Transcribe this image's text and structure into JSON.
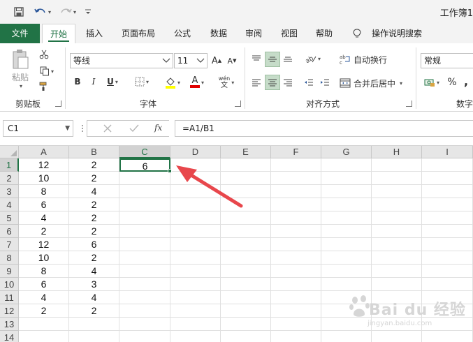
{
  "window": {
    "title": "工作簿1"
  },
  "qat": {
    "save_icon": "save-icon",
    "undo_icon": "undo-icon",
    "redo_icon": "redo-icon",
    "customize_icon": "qat-customize-icon"
  },
  "tabs": [
    {
      "id": "file",
      "label": "文件"
    },
    {
      "id": "home",
      "label": "开始"
    },
    {
      "id": "insert",
      "label": "插入"
    },
    {
      "id": "layout",
      "label": "页面布局"
    },
    {
      "id": "formulas",
      "label": "公式"
    },
    {
      "id": "data",
      "label": "数据"
    },
    {
      "id": "review",
      "label": "审阅"
    },
    {
      "id": "view",
      "label": "视图"
    },
    {
      "id": "help",
      "label": "帮助"
    },
    {
      "id": "tellme",
      "label": "操作说明搜索"
    }
  ],
  "ribbon": {
    "clipboard": {
      "paste_label": "粘贴",
      "group_label": "剪贴板"
    },
    "font": {
      "font_name": "等线",
      "font_size": "11",
      "group_label": "字体",
      "bold": "B",
      "italic": "I",
      "underline": "U",
      "grow": "A",
      "shrink": "A",
      "font_color_label": "A",
      "phonetic": "wén"
    },
    "alignment": {
      "wrap_text": "自动换行",
      "merge_center": "合并后居中",
      "group_label": "对齐方式"
    },
    "number": {
      "format": "常规",
      "percent": "%",
      "comma": ",",
      "group_label": "数字"
    }
  },
  "formula_bar": {
    "name_box": "C1",
    "fx_label": "fx",
    "formula": "=A1/B1"
  },
  "columns": [
    "A",
    "B",
    "C",
    "D",
    "E",
    "F",
    "G",
    "H",
    "I"
  ],
  "rows": [
    "1",
    "2",
    "3",
    "4",
    "5",
    "6",
    "7",
    "8",
    "9",
    "10",
    "11",
    "12",
    "13",
    "14"
  ],
  "col_a": [
    "12",
    "10",
    "8",
    "6",
    "4",
    "2",
    "12",
    "10",
    "8",
    "6",
    "4",
    "2"
  ],
  "col_b": [
    "2",
    "2",
    "4",
    "2",
    "2",
    "2",
    "6",
    "2",
    "4",
    "3",
    "4",
    "2"
  ],
  "col_c": [
    "6"
  ],
  "selected_cell": "C1",
  "accent_color": "#217346",
  "annotation_color": "#e8474c",
  "watermark": {
    "main": "Bai du 经验",
    "sub": "jingyan.baidu.com"
  }
}
